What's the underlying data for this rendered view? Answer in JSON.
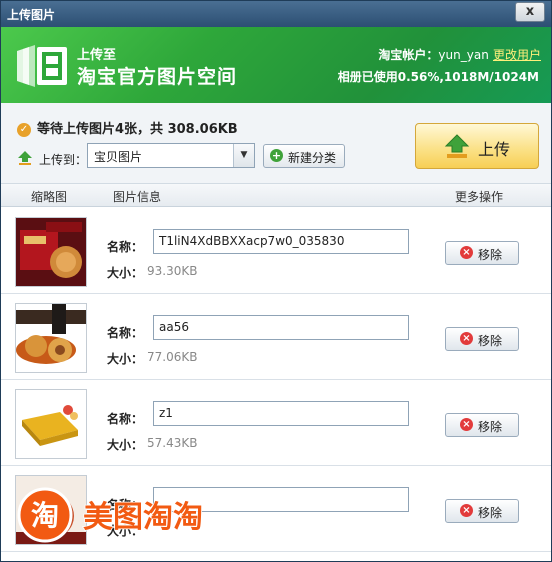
{
  "window": {
    "title": "上传图片",
    "close_glyph": "x"
  },
  "banner": {
    "subtitle": "上传至",
    "title": "淘宝官方图片空间",
    "account_label": "淘宝帐户：",
    "account_user": "yun_yan",
    "change_user_link": "更改用户",
    "usage": "相册已使用0.56%,1018M/1024M",
    "logo_icon": "image-space-logo-icon"
  },
  "upload": {
    "status": "等待上传图片4张，共  308.06KB",
    "target_label": "上传到：",
    "target_value": "宝贝图片",
    "new_category": "新建分类",
    "upload_button": "上传"
  },
  "columns": {
    "thumb": "缩略图",
    "info": "图片信息",
    "more": "更多操作"
  },
  "labels": {
    "name": "名称：",
    "size": "大小：",
    "remove": "移除"
  },
  "items": [
    {
      "name": "T1liN4XdBBXXacp7w0_035830",
      "size": "93.30KB",
      "thumb": "mooncake-red-box"
    },
    {
      "name": "aa56",
      "size": "77.06KB",
      "thumb": "mooncake-plate"
    },
    {
      "name": "z1",
      "size": "57.43KB",
      "thumb": "gold-gift-box"
    },
    {
      "name": "",
      "size": "",
      "thumb": "mooncake-covered"
    }
  ],
  "watermark": {
    "text": "美图淘淘",
    "icon_glyph": "淘"
  },
  "colors": {
    "accent_green": "#2ea73a",
    "upload_yellow": "#fbe28a",
    "remove_red": "#e23b3b",
    "watermark_orange": "#f25a12"
  }
}
